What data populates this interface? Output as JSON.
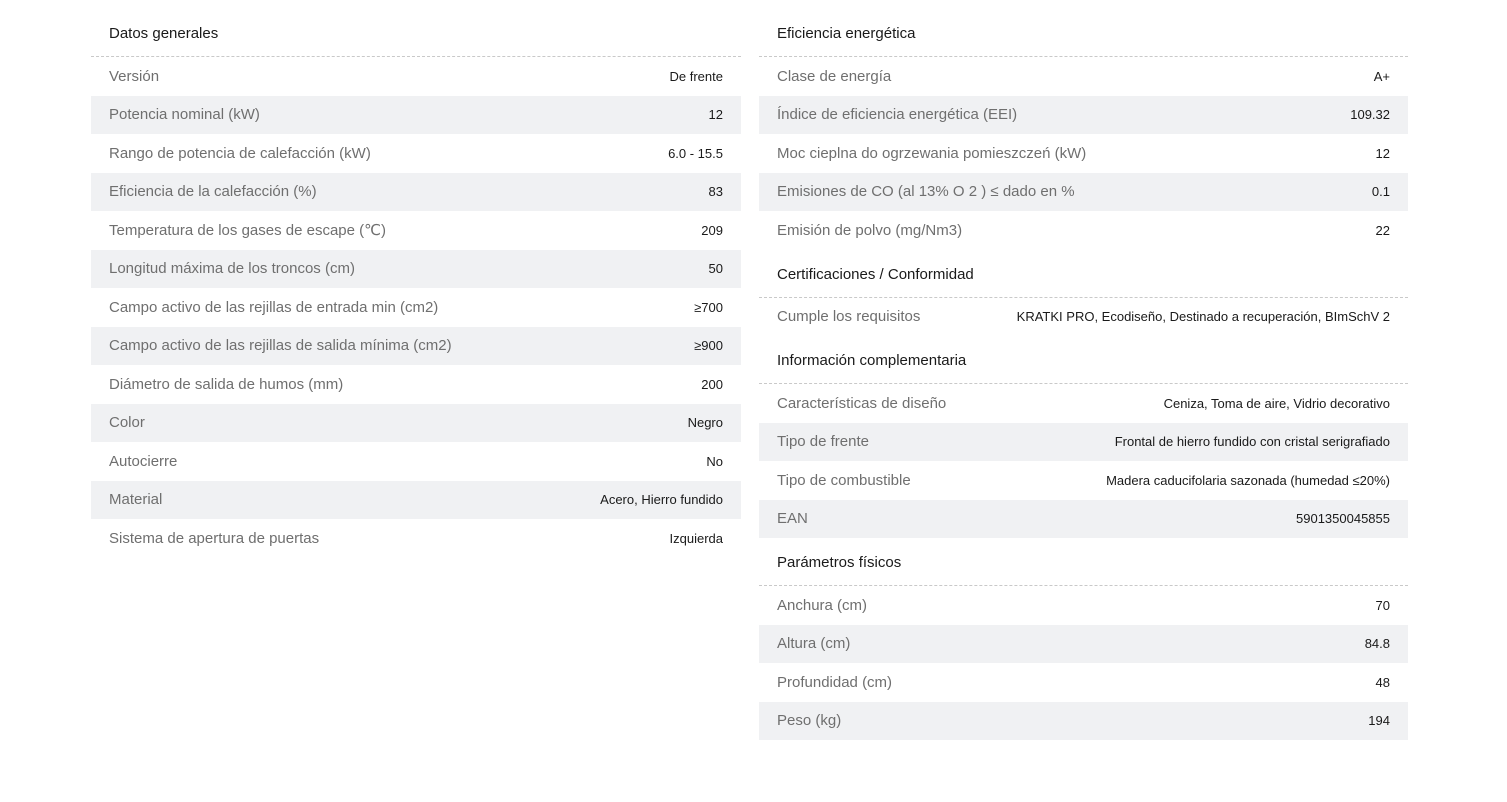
{
  "left": {
    "sections": [
      {
        "title": "Datos generales",
        "rows": [
          {
            "label": "Versión",
            "value": "De frente"
          },
          {
            "label": "Potencia nominal (kW)",
            "value": "12"
          },
          {
            "label": "Rango de potencia de calefacción (kW)",
            "value": "6.0 - 15.5"
          },
          {
            "label": "Eficiencia de la calefacción (%)",
            "value": "83"
          },
          {
            "label": "Temperatura de los gases de escape (℃)",
            "value": "209"
          },
          {
            "label": "Longitud máxima de los troncos (cm)",
            "value": "50"
          },
          {
            "label": "Campo activo de las rejillas de entrada min (cm2)",
            "value": "≥700"
          },
          {
            "label": "Campo activo de las rejillas de salida mínima (cm2)",
            "value": "≥900"
          },
          {
            "label": "Diámetro de salida de humos (mm)",
            "value": "200"
          },
          {
            "label": "Color",
            "value": "Negro"
          },
          {
            "label": "Autocierre",
            "value": "No"
          },
          {
            "label": "Material",
            "value": "Acero, Hierro fundido"
          },
          {
            "label": "Sistema de apertura de puertas",
            "value": "Izquierda"
          }
        ]
      }
    ]
  },
  "right": {
    "sections": [
      {
        "title": "Eficiencia energética",
        "rows": [
          {
            "label": "Clase de energía",
            "value": "A+"
          },
          {
            "label": "Índice de eficiencia energética (EEI)",
            "value": "109.32"
          },
          {
            "label": "Moc cieplna do ogrzewania pomieszczeń (kW)",
            "value": "12"
          },
          {
            "label": "Emisiones de CO (al 13% O 2 ) ≤ dado en %",
            "value": "0.1"
          },
          {
            "label": "Emisión de polvo (mg/Nm3)",
            "value": "22"
          }
        ]
      },
      {
        "title": "Certificaciones / Conformidad",
        "rows": [
          {
            "label": "Cumple los requisitos",
            "value": "KRATKI PRO, Ecodiseño, Destinado a recuperación, BImSchV 2"
          }
        ]
      },
      {
        "title": "Información complementaria",
        "rows": [
          {
            "label": "Características de diseño",
            "value": "Ceniza, Toma de aire, Vidrio decorativo"
          },
          {
            "label": "Tipo de frente",
            "value": "Frontal de hierro fundido con cristal serigrafiado"
          },
          {
            "label": "Tipo de combustible",
            "value": "Madera caducifolaria sazonada (humedad ≤20%)"
          },
          {
            "label": "EAN",
            "value": "5901350045855"
          }
        ]
      },
      {
        "title": "Parámetros físicos",
        "rows": [
          {
            "label": "Anchura (cm)",
            "value": "70"
          },
          {
            "label": "Altura (cm)",
            "value": "84.8"
          },
          {
            "label": "Profundidad (cm)",
            "value": "48"
          },
          {
            "label": "Peso (kg)",
            "value": "194"
          }
        ]
      }
    ]
  }
}
